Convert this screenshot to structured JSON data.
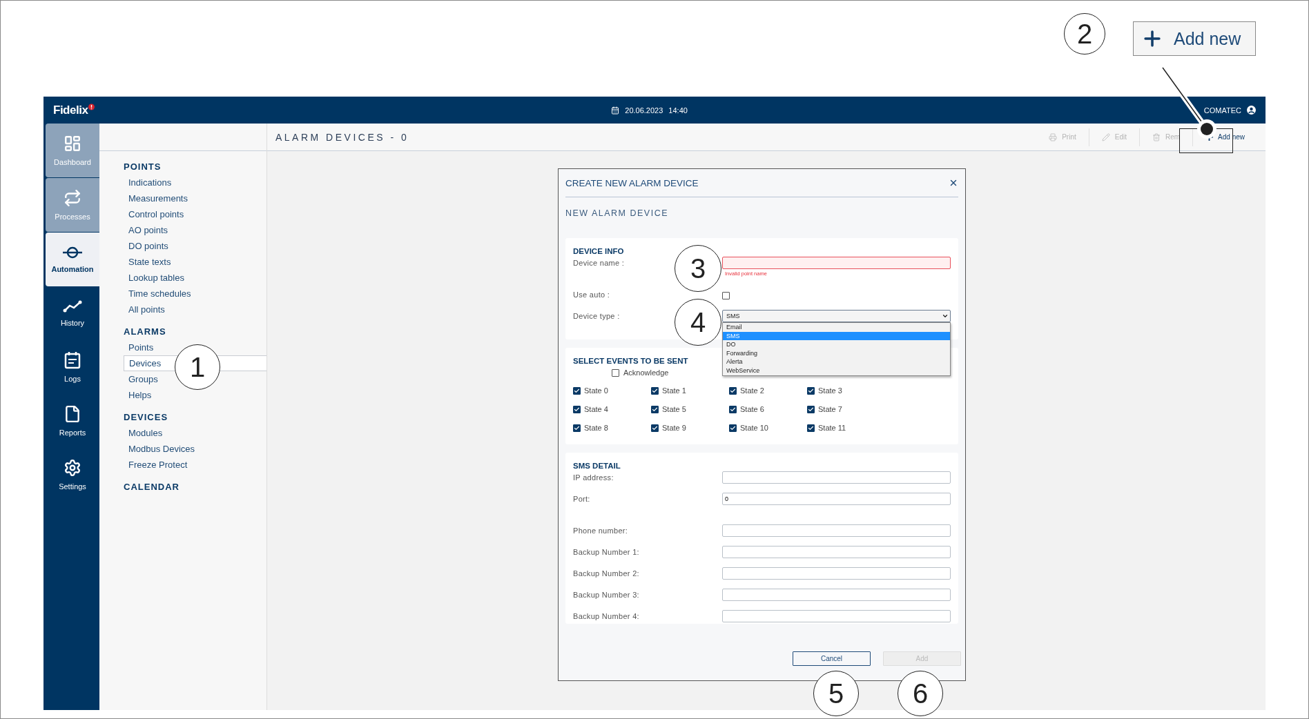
{
  "top_bar": {
    "logo": "Fidelix",
    "date": "20.06.2023",
    "time": "14:40",
    "user": "COMATEC"
  },
  "nav_rail": [
    {
      "label": "Dashboard",
      "selected": false,
      "pinned": true
    },
    {
      "label": "Processes",
      "selected": false,
      "pinned": true
    },
    {
      "label": "Automation",
      "selected": true,
      "pinned": false
    },
    {
      "label": "History",
      "selected": false,
      "pinned": false
    },
    {
      "label": "Logs",
      "selected": false,
      "pinned": false
    },
    {
      "label": "Reports",
      "selected": false,
      "pinned": false
    },
    {
      "label": "Settings",
      "selected": false,
      "pinned": false
    }
  ],
  "sidebar": {
    "sections": [
      {
        "title": "POINTS",
        "items": [
          {
            "label": "Indications",
            "selected": false
          },
          {
            "label": "Measurements",
            "selected": false
          },
          {
            "label": "Control points",
            "selected": false
          },
          {
            "label": "AO points",
            "selected": false
          },
          {
            "label": "DO points",
            "selected": false
          },
          {
            "label": "State texts",
            "selected": false
          },
          {
            "label": "Lookup tables",
            "selected": false
          },
          {
            "label": "Time schedules",
            "selected": false
          },
          {
            "label": "All points",
            "selected": false
          }
        ]
      },
      {
        "title": "ALARMS",
        "items": [
          {
            "label": "Points",
            "selected": false
          },
          {
            "label": "Devices",
            "selected": true
          },
          {
            "label": "Groups",
            "selected": false
          },
          {
            "label": "Helps",
            "selected": false
          }
        ]
      },
      {
        "title": "DEVICES",
        "items": [
          {
            "label": "Modules",
            "selected": false
          },
          {
            "label": "Modbus Devices",
            "selected": false
          },
          {
            "label": "Freeze Protect",
            "selected": false
          }
        ]
      },
      {
        "title": "CALENDAR"
      }
    ]
  },
  "page": {
    "title": "ALARM DEVICES - 0",
    "toolbar": [
      {
        "label": "Print",
        "disabled": true
      },
      {
        "label": "Edit",
        "disabled": true
      },
      {
        "label": "Rem",
        "disabled": true
      },
      {
        "label": "Add new",
        "disabled": false
      }
    ]
  },
  "dialog": {
    "title": "CREATE NEW ALARM DEVICE",
    "subtitle": "NEW ALARM DEVICE",
    "device_info": {
      "title": "DEVICE INFO",
      "name": {
        "label": "Device name :",
        "invalid": true,
        "error": "Invalid point name"
      },
      "use_auto": {
        "label": "Use auto :",
        "checked": false
      },
      "device_type": {
        "label": "Device type :",
        "value": "SMS",
        "expanded": true,
        "options": [
          {
            "label": "Email",
            "selected": false
          },
          {
            "label": "SMS",
            "selected": true
          },
          {
            "label": "DO",
            "selected": false
          },
          {
            "label": "Forwarding",
            "selected": false
          },
          {
            "label": "Alerta",
            "selected": false
          },
          {
            "label": "WebService",
            "selected": false
          }
        ]
      }
    },
    "events": {
      "title": "SELECT EVENTS TO BE SENT",
      "acknowledge": {
        "label": "Acknowledge",
        "checked": false
      },
      "states": [
        {
          "label": "State 0",
          "checked": true
        },
        {
          "label": "State 1",
          "checked": true
        },
        {
          "label": "State 2",
          "checked": true
        },
        {
          "label": "State 3",
          "checked": true
        },
        {
          "label": "State 4",
          "checked": true
        },
        {
          "label": "State 5",
          "checked": true
        },
        {
          "label": "State 6",
          "checked": true
        },
        {
          "label": "State 7",
          "checked": true
        },
        {
          "label": "State 8",
          "checked": true
        },
        {
          "label": "State 9",
          "checked": true
        },
        {
          "label": "State 10",
          "checked": true
        },
        {
          "label": "State 11",
          "checked": true
        }
      ]
    },
    "sms_detail": {
      "title": "SMS DETAIL",
      "field_groups": [
        [
          {
            "label": "IP address:"
          },
          {
            "label": "Port:",
            "value": "0"
          }
        ],
        [
          {
            "label": "Phone number:"
          },
          {
            "label": "Backup Number 1:"
          },
          {
            "label": "Backup Number 2:"
          },
          {
            "label": "Backup Number 3:"
          },
          {
            "label": "Backup Number 4:"
          }
        ]
      ]
    },
    "buttons": [
      {
        "label": "Cancel",
        "disabled": false
      },
      {
        "label": "Add",
        "disabled": true
      }
    ]
  },
  "callouts": [
    {
      "number": "1"
    },
    {
      "number": "2"
    },
    {
      "number": "3"
    },
    {
      "number": "4"
    },
    {
      "number": "5"
    },
    {
      "number": "6"
    }
  ],
  "inset": {
    "label": "Add new"
  }
}
